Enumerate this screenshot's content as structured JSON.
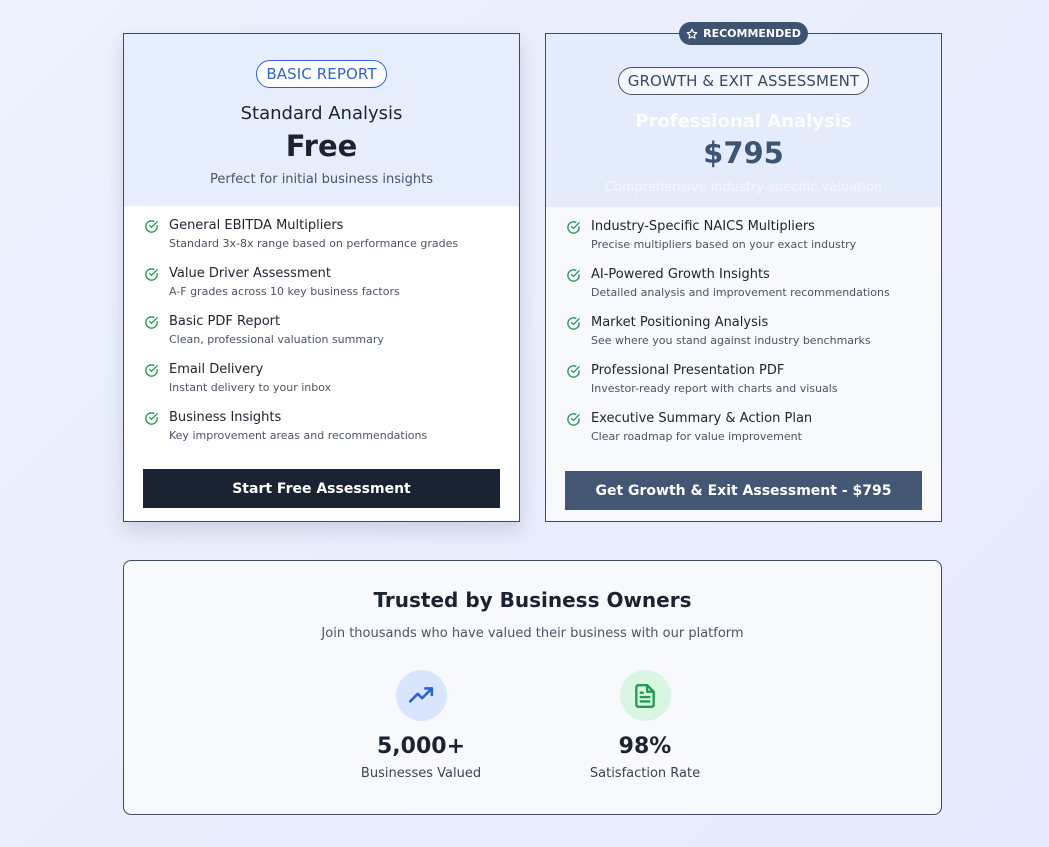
{
  "colors": {
    "accent_blue": "#2d62d6",
    "check_green": "#1f9d55",
    "dark_button": "#1b2332",
    "slate_button": "#435775"
  },
  "badge": {
    "icon": "star-icon",
    "label": "RECOMMENDED"
  },
  "basic": {
    "pill": "BASIC REPORT",
    "title": "Standard Analysis",
    "price": "Free",
    "description": "Perfect for initial business insights",
    "features": [
      {
        "title": "General EBITDA Multipliers",
        "desc": "Standard 3x-8x range based on performance grades"
      },
      {
        "title": "Value Driver Assessment",
        "desc": "A-F grades across 10 key business factors"
      },
      {
        "title": "Basic PDF Report",
        "desc": "Clean, professional valuation summary"
      },
      {
        "title": "Email Delivery",
        "desc": "Instant delivery to your inbox"
      },
      {
        "title": "Business Insights",
        "desc": "Key improvement areas and recommendations"
      }
    ],
    "cta": "Start Free Assessment"
  },
  "pro": {
    "pill": "GROWTH & EXIT ASSESSMENT",
    "title": "Professional Analysis",
    "price": "$795",
    "description": "Comprehensive industry-specific valuation",
    "features": [
      {
        "title": "Industry-Specific NAICS Multipliers",
        "desc": "Precise multipliers based on your exact industry"
      },
      {
        "title": "AI-Powered Growth Insights",
        "desc": "Detailed analysis and improvement recommendations"
      },
      {
        "title": "Market Positioning Analysis",
        "desc": "See where you stand against industry benchmarks"
      },
      {
        "title": "Professional Presentation PDF",
        "desc": "Investor-ready report with charts and visuals"
      },
      {
        "title": "Executive Summary & Action Plan",
        "desc": "Clear roadmap for value improvement"
      }
    ],
    "cta": "Get Growth & Exit Assessment - $795"
  },
  "trust": {
    "title": "Trusted by Business Owners",
    "subtitle": "Join thousands who have valued their business with our platform",
    "stats": [
      {
        "icon": "trending-up-icon",
        "value": "5,000+",
        "label": "Businesses Valued"
      },
      {
        "icon": "document-icon",
        "value": "98%",
        "label": "Satisfaction Rate"
      }
    ]
  }
}
